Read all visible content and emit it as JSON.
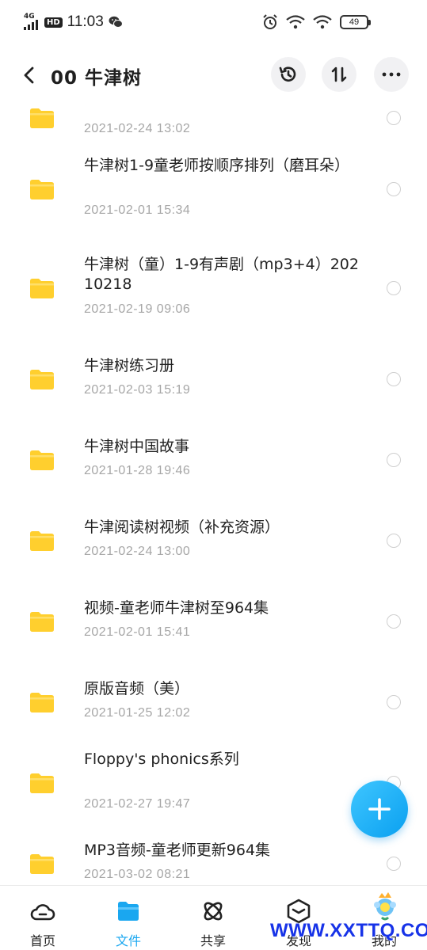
{
  "status_bar": {
    "network": "4G",
    "hd_badge": "HD",
    "time": "11:03",
    "battery": "49"
  },
  "header": {
    "title": "00 牛津树"
  },
  "files": [
    {
      "name": "",
      "date": "2021-02-24  13:02",
      "partial": true
    },
    {
      "name": "牛津树1-9童老师按顺序排列（磨耳朵）",
      "date": "2021-02-01  15:34"
    },
    {
      "name": "牛津树（童）1-9有声剧（mp3+4）20210218",
      "date": "2021-02-19  09:06"
    },
    {
      "name": "牛津树练习册",
      "date": "2021-02-03  15:19"
    },
    {
      "name": "牛津树中国故事",
      "date": "2021-01-28  19:46"
    },
    {
      "name": "牛津阅读树视频（补充资源）",
      "date": "2021-02-24  13:00"
    },
    {
      "name": "视频-童老师牛津树至964集",
      "date": "2021-02-01  15:41"
    },
    {
      "name": "原版音频（美）",
      "date": "2021-01-25  12:02"
    },
    {
      "name": "Floppy's phonics系列",
      "date": "2021-02-27  19:47"
    },
    {
      "name": "MP3音频-童老师更新964集",
      "date": "2021-03-02  08:21"
    }
  ],
  "bottom_nav": [
    {
      "label": "首页",
      "icon": "cloud-icon",
      "active": false
    },
    {
      "label": "文件",
      "icon": "folder-icon",
      "active": true
    },
    {
      "label": "共享",
      "icon": "atom-icon",
      "active": false
    },
    {
      "label": "发现",
      "icon": "cube-icon",
      "active": false
    },
    {
      "label": "我的",
      "icon": "profile-icon",
      "active": false
    }
  ],
  "watermark": "WWW.XXTTQ.COM",
  "colors": {
    "accent": "#1aa7f0",
    "folder": "#ffcf2e",
    "date_text": "#a6a6a6",
    "watermark": "#1733e8"
  }
}
